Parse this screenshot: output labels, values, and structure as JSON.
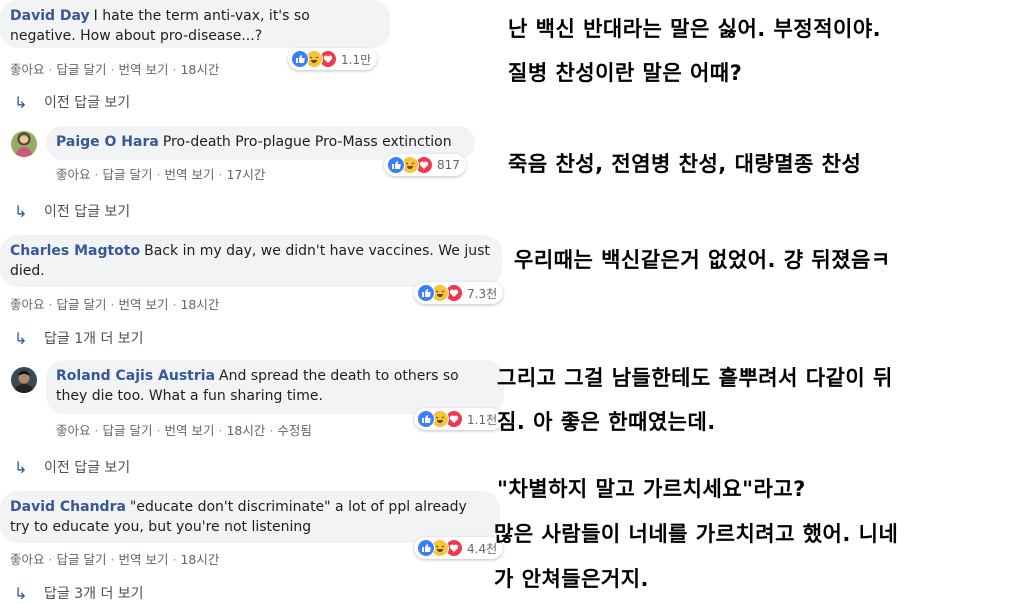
{
  "comments": [
    {
      "author": "David Day",
      "text": "I hate the term anti-vax, it's so negative. How about pro-disease...?",
      "like": "좋아요",
      "reply": "답글 달기",
      "translate": "번역 보기",
      "time": "18시간",
      "reactions": "1.1만"
    },
    {
      "author": "Paige O Hara",
      "text": "Pro-death Pro-plague Pro-Mass extinction",
      "like": "좋아요",
      "reply": "답글 달기",
      "translate": "번역 보기",
      "time": "17시간",
      "reactions": "817"
    },
    {
      "author": "Charles Magtoto",
      "text": "Back in my day, we didn't have vaccines. We just died.",
      "like": "좋아요",
      "reply": "답글 달기",
      "translate": "번역 보기",
      "time": "18시간",
      "reactions": "7.3천"
    },
    {
      "author": "Roland Cajis Austria",
      "text": "And spread the death to others so they die too. What a fun sharing time.",
      "like": "좋아요",
      "reply": "답글 달기",
      "translate": "번역 보기",
      "time": "18시간",
      "edited": "수정됨",
      "reactions": "1.1천"
    },
    {
      "author": "David Chandra",
      "text": "\"educate don't discriminate\" a lot of ppl already try to educate you, but you're not listening",
      "like": "좋아요",
      "reply": "답글 달기",
      "translate": "번역 보기",
      "time": "18시간",
      "reactions": "4.4천"
    }
  ],
  "more_links": [
    "이전 답글 보기",
    "이전 답글 보기",
    "답글 1개 더 보기",
    "이전 답글 보기",
    "답글 3개 더 보기"
  ],
  "translation": [
    "난 백신 반대라는 말은 싫어. 부정적이야.",
    "질병 찬성이란 말은 어때?",
    "죽음 찬성, 전염병 찬성, 대량멸종 찬성",
    "우리때는 백신같은거 없었어. 걍 뒤졌음ㅋ",
    "그리고 그걸 남들한테도 흩뿌려서 다같이 뒤",
    "짐. 아 좋은 한때였는데.",
    "\"차별하지 말고 가르치세요\"라고?",
    "많은 사람들이 너네를 가르치려고 했어. 니네",
    "가 안쳐들은거지."
  ],
  "colors": {
    "author": "#365899",
    "bubble": "#f2f3f5",
    "meta": "#606770",
    "like": "#3b7dff",
    "haha": "#f7c33c",
    "love": "#f0384f"
  }
}
